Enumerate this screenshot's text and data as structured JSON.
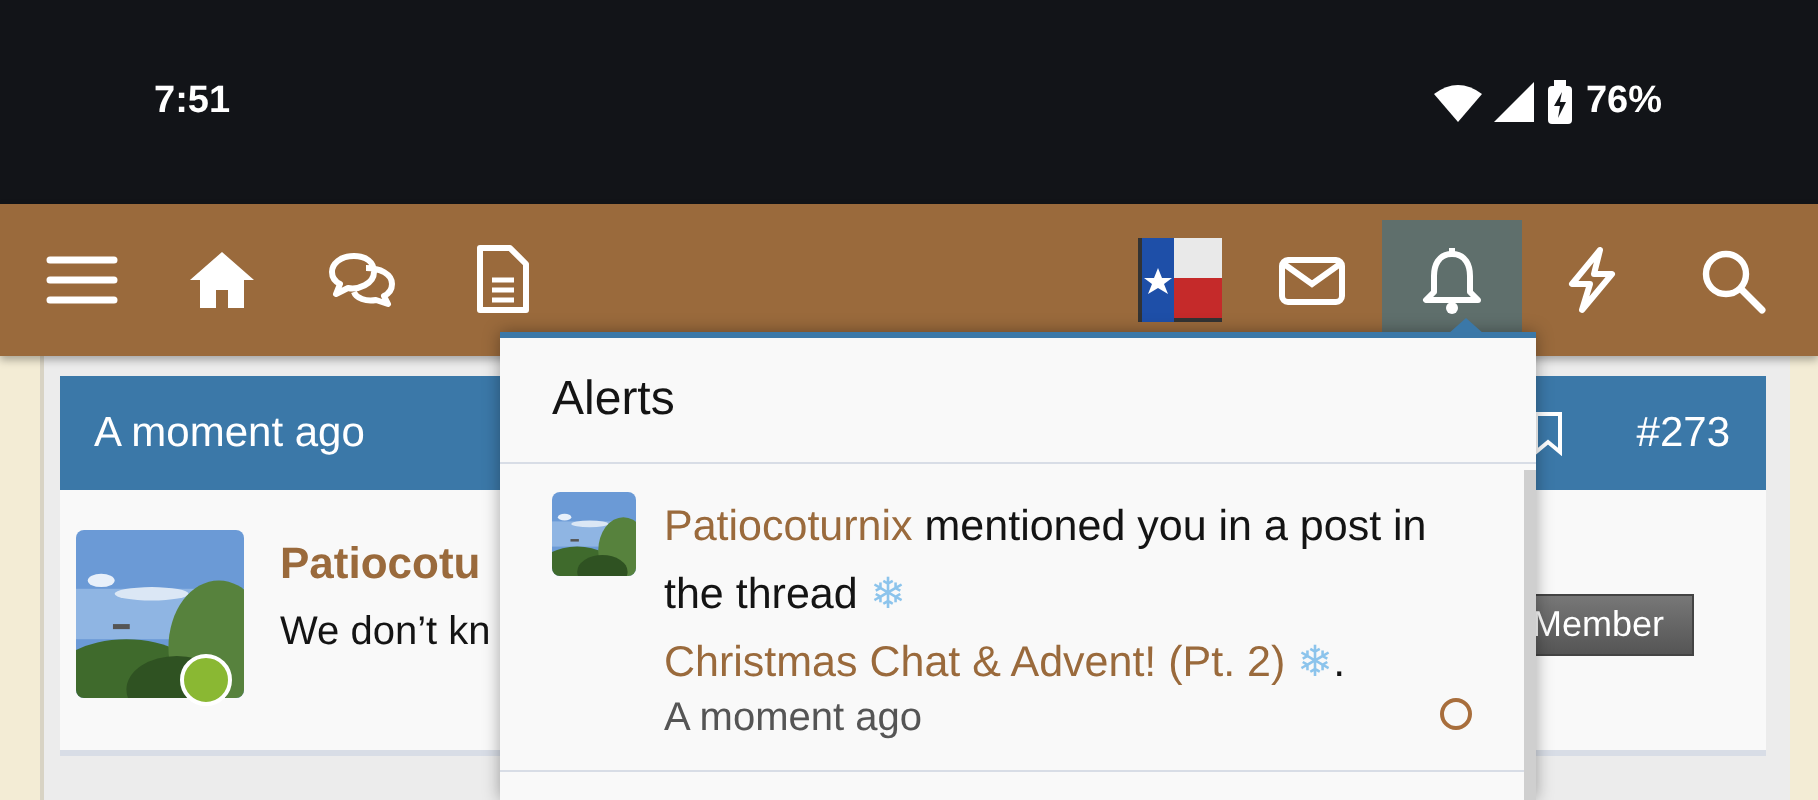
{
  "status_bar": {
    "time": "7:51",
    "battery": "76%"
  },
  "nav": {
    "items": [
      {
        "kind": "menu",
        "selected": false
      },
      {
        "kind": "home",
        "selected": false
      },
      {
        "kind": "chat",
        "selected": false
      },
      {
        "kind": "doc",
        "selected": false
      },
      {
        "kind": "avatar",
        "selected": false
      },
      {
        "kind": "mail",
        "selected": false
      },
      {
        "kind": "bell",
        "selected": true
      },
      {
        "kind": "bolt",
        "selected": false
      },
      {
        "kind": "search",
        "selected": false
      }
    ]
  },
  "post": {
    "time": "A moment ago",
    "number": "#273",
    "author": "Patiocotu",
    "online": true,
    "text": "We don’t kn",
    "badge": "Member"
  },
  "alerts": {
    "title": "Alerts",
    "items": [
      {
        "parts": [
          {
            "kind": "user",
            "text": "Patiocoturnix"
          },
          {
            "kind": "text",
            "text": " mentioned you in a post in the thread "
          },
          {
            "kind": "emoji",
            "text": "❄ "
          },
          {
            "kind": "link",
            "text": "Christmas Chat & Advent! (Pt. 2)"
          },
          {
            "kind": "emoji",
            "text": " ❄"
          },
          {
            "kind": "text",
            "text": "."
          }
        ],
        "time": "A moment ago",
        "unread": true
      }
    ]
  }
}
